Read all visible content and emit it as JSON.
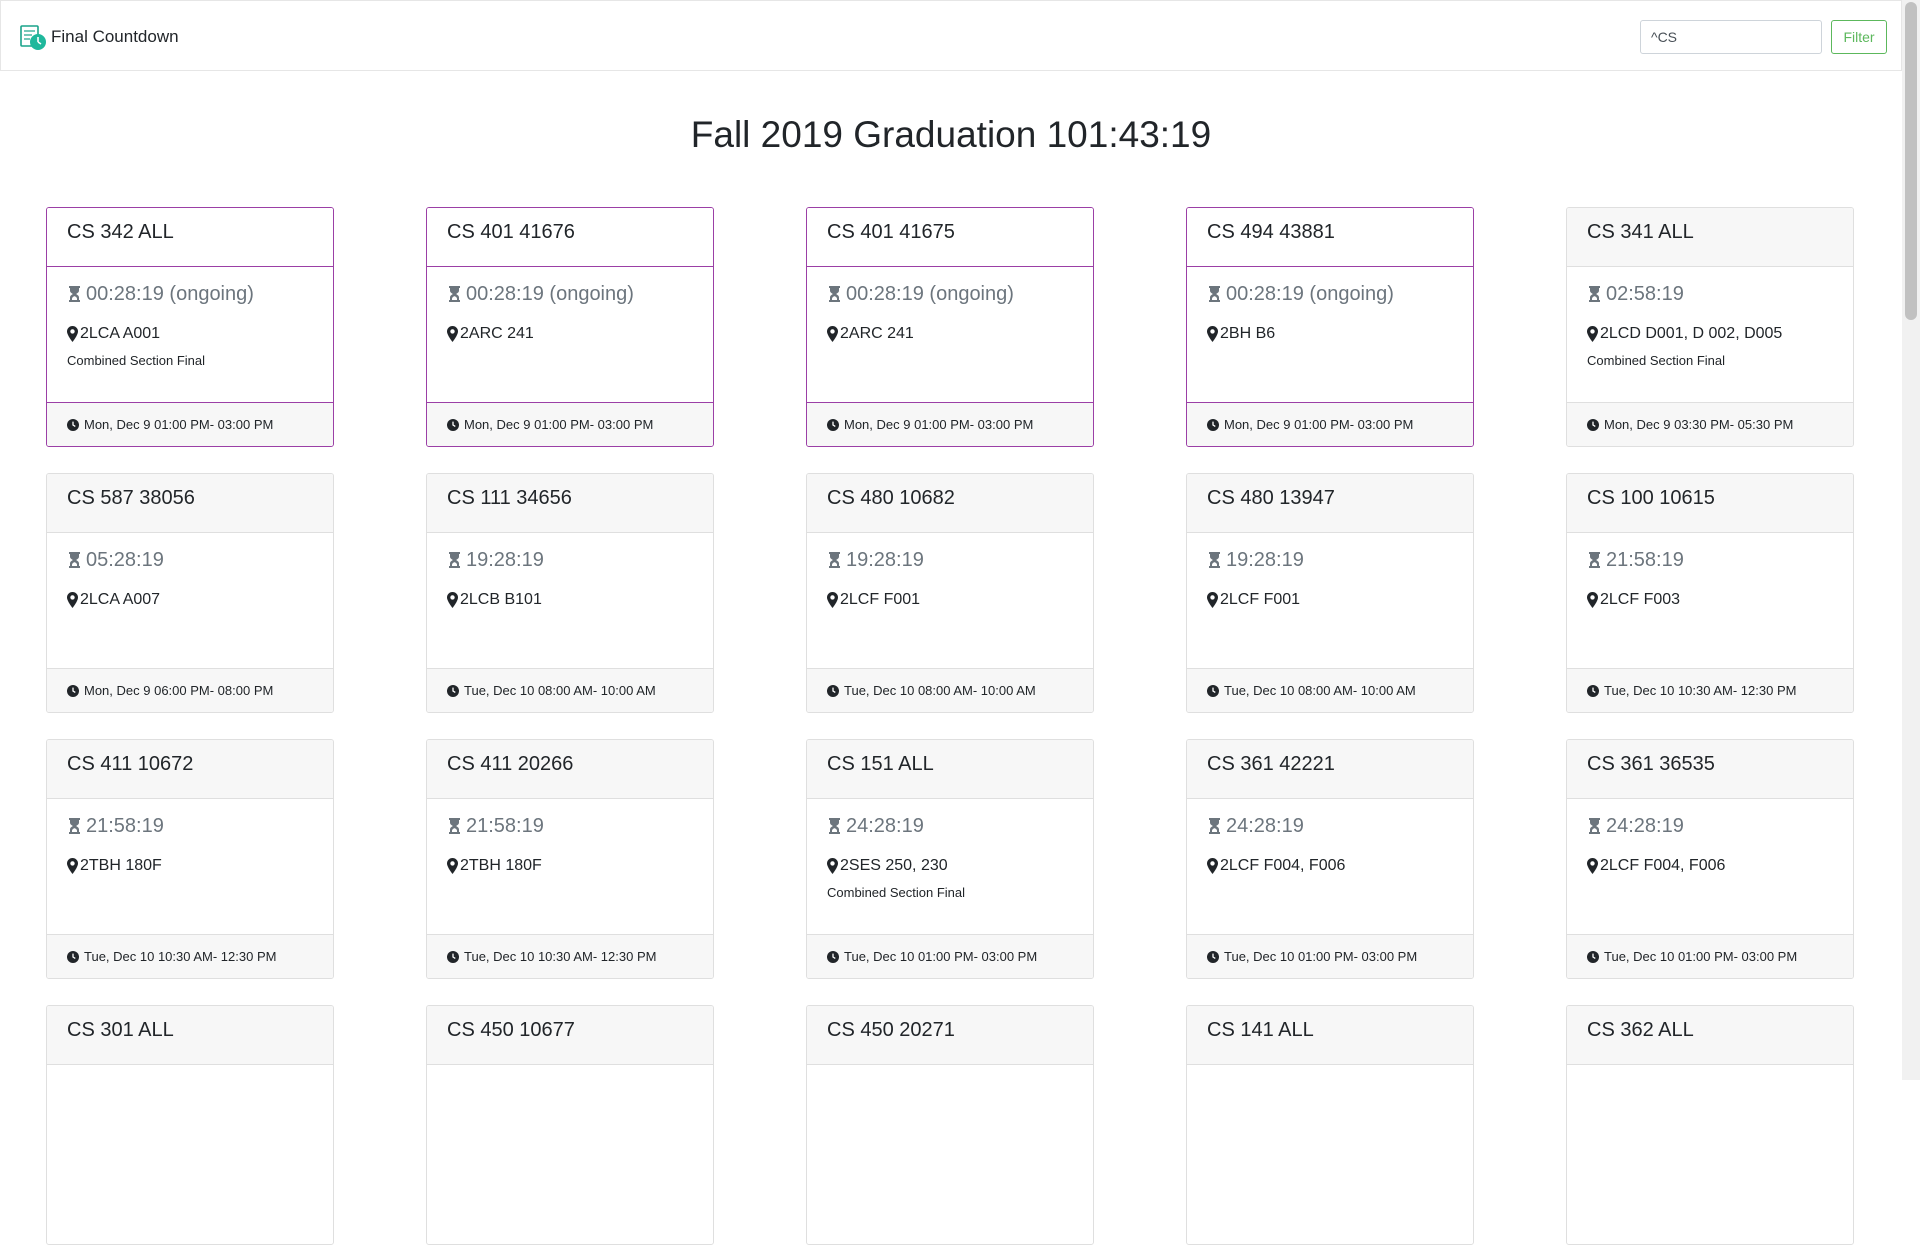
{
  "app": {
    "title": "Final Countdown"
  },
  "filter": {
    "value": "^CS",
    "button_label": "Filter"
  },
  "page": {
    "title": "Fall 2019 Graduation 101:43:19"
  },
  "colors": {
    "ongoing_border": "#9b3fa6",
    "filter_button": "#5cb85c",
    "countdown_text": "#6c757d"
  },
  "icons": {
    "brand": "calendar-clock-icon",
    "countdown": "hourglass-icon",
    "location": "map-marker-icon",
    "time": "clock-icon"
  },
  "exams": [
    {
      "course": "CS 342 ALL",
      "countdown": "00:28:19 (ongoing)",
      "ongoing": true,
      "location": "2LCA A001",
      "note": "Combined Section Final",
      "time": "Mon, Dec 9 01:00 PM- 03:00 PM"
    },
    {
      "course": "CS 401 41676",
      "countdown": "00:28:19 (ongoing)",
      "ongoing": true,
      "location": "2ARC 241",
      "note": "",
      "time": "Mon, Dec 9 01:00 PM- 03:00 PM"
    },
    {
      "course": "CS 401 41675",
      "countdown": "00:28:19 (ongoing)",
      "ongoing": true,
      "location": "2ARC 241",
      "note": "",
      "time": "Mon, Dec 9 01:00 PM- 03:00 PM"
    },
    {
      "course": "CS 494 43881",
      "countdown": "00:28:19 (ongoing)",
      "ongoing": true,
      "location": "2BH B6",
      "note": "",
      "time": "Mon, Dec 9 01:00 PM- 03:00 PM"
    },
    {
      "course": "CS 341 ALL",
      "countdown": "02:58:19",
      "ongoing": false,
      "location": "2LCD D001, D 002, D005",
      "note": "Combined Section Final",
      "time": "Mon, Dec 9 03:30 PM- 05:30 PM"
    },
    {
      "course": "CS 587 38056",
      "countdown": "05:28:19",
      "ongoing": false,
      "location": "2LCA A007",
      "note": "",
      "time": "Mon, Dec 9 06:00 PM- 08:00 PM"
    },
    {
      "course": "CS 111 34656",
      "countdown": "19:28:19",
      "ongoing": false,
      "location": "2LCB B101",
      "note": "",
      "time": "Tue, Dec 10 08:00 AM- 10:00 AM"
    },
    {
      "course": "CS 480 10682",
      "countdown": "19:28:19",
      "ongoing": false,
      "location": "2LCF F001",
      "note": "",
      "time": "Tue, Dec 10 08:00 AM- 10:00 AM"
    },
    {
      "course": "CS 480 13947",
      "countdown": "19:28:19",
      "ongoing": false,
      "location": "2LCF F001",
      "note": "",
      "time": "Tue, Dec 10 08:00 AM- 10:00 AM"
    },
    {
      "course": "CS 100 10615",
      "countdown": "21:58:19",
      "ongoing": false,
      "location": "2LCF F003",
      "note": "",
      "time": "Tue, Dec 10 10:30 AM- 12:30 PM"
    },
    {
      "course": "CS 411 10672",
      "countdown": "21:58:19",
      "ongoing": false,
      "location": "2TBH 180F",
      "note": "",
      "time": "Tue, Dec 10 10:30 AM- 12:30 PM"
    },
    {
      "course": "CS 411 20266",
      "countdown": "21:58:19",
      "ongoing": false,
      "location": "2TBH 180F",
      "note": "",
      "time": "Tue, Dec 10 10:30 AM- 12:30 PM"
    },
    {
      "course": "CS 151 ALL",
      "countdown": "24:28:19",
      "ongoing": false,
      "location": "2SES 250, 230",
      "note": "Combined Section Final",
      "time": "Tue, Dec 10 01:00 PM- 03:00 PM"
    },
    {
      "course": "CS 361 42221",
      "countdown": "24:28:19",
      "ongoing": false,
      "location": "2LCF F004, F006",
      "note": "",
      "time": "Tue, Dec 10 01:00 PM- 03:00 PM"
    },
    {
      "course": "CS 361 36535",
      "countdown": "24:28:19",
      "ongoing": false,
      "location": "2LCF F004, F006",
      "note": "",
      "time": "Tue, Dec 10 01:00 PM- 03:00 PM"
    },
    {
      "course": "CS 301 ALL"
    },
    {
      "course": "CS 450 10677"
    },
    {
      "course": "CS 450 20271"
    },
    {
      "course": "CS 141 ALL"
    },
    {
      "course": "CS 362 ALL"
    }
  ]
}
